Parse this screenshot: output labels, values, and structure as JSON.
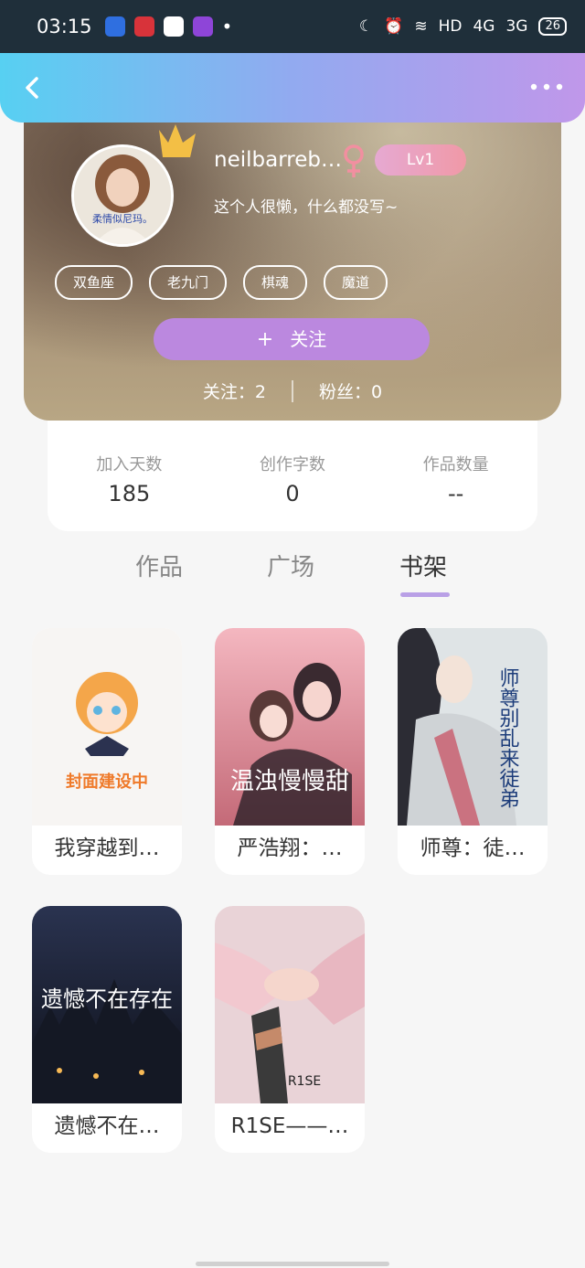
{
  "statusbar": {
    "time": "03:15",
    "dot": "•",
    "hd": "HD",
    "net1": "4G",
    "net2": "3G",
    "battery": "26"
  },
  "profile": {
    "nickname": "neilbarreb…",
    "gender_symbol": "♀",
    "level": "Lv1",
    "bio": "这个人很懒，什么都没写~",
    "avatar_caption": "柔情似尼玛。",
    "tags": [
      "双鱼座",
      "老九门",
      "棋魂",
      "魔道"
    ],
    "follow_plus": "+",
    "follow_label": "关注",
    "following": "关注：2",
    "fans": "粉丝：0"
  },
  "stats": [
    {
      "label": "加入天数",
      "value": "185"
    },
    {
      "label": "创作字数",
      "value": "0"
    },
    {
      "label": "作品数量",
      "value": "--"
    }
  ],
  "tabs": [
    "作品",
    "广场",
    "书架"
  ],
  "active_tab": "书架",
  "books": [
    {
      "title": "我穿越到…",
      "cover_text": "封面建设中"
    },
    {
      "title": "严浩翔：…",
      "cover_text": "温浊慢慢甜"
    },
    {
      "title": "师尊：徒…",
      "cover_text": "师尊别乱来徒弟"
    },
    {
      "title": "遗憾不在…",
      "cover_text": "遗憾不在存在"
    },
    {
      "title": "R1SE——…",
      "cover_text": "R1SE"
    }
  ],
  "colors": {
    "accent": "#bb88df",
    "header_start": "#57d0f2",
    "header_end": "#c097ea"
  }
}
